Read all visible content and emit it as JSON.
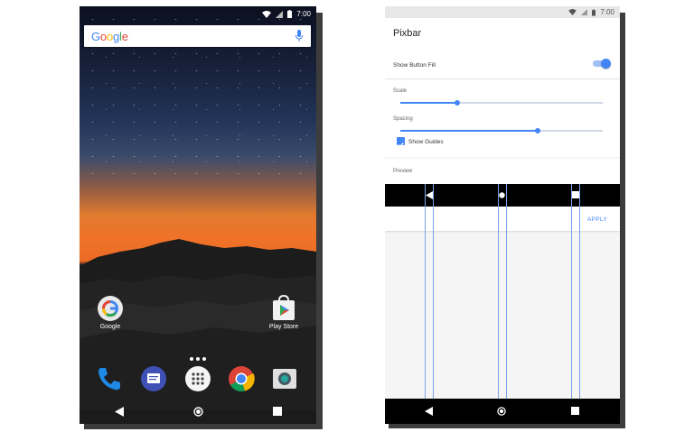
{
  "status_bar": {
    "time": "7:00"
  },
  "home": {
    "search": {
      "logo": "Google",
      "mic_icon": "mic-icon"
    },
    "apps": [
      {
        "label": "Google",
        "icon": "google-app-icon"
      },
      {
        "label": "Play Store",
        "icon": "play-store-icon"
      }
    ],
    "dock": [
      "phone-icon",
      "messages-icon",
      "app-drawer-icon",
      "chrome-icon",
      "camera-icon"
    ],
    "nav": [
      "back-icon",
      "home-icon",
      "recents-icon"
    ]
  },
  "pixbar": {
    "title": "Pixbar",
    "show_button_fill": {
      "label": "Show Button Fill",
      "on": true
    },
    "scale": {
      "label": "Scale",
      "value": 0.28
    },
    "spacing": {
      "label": "Spacing",
      "value": 0.68
    },
    "show_guides": {
      "label": "Show Guides",
      "checked": true
    },
    "preview_label": "Preview",
    "apply_label": "APPLY"
  },
  "colors": {
    "accent": "#4285f4",
    "sunset": "#f07228"
  }
}
